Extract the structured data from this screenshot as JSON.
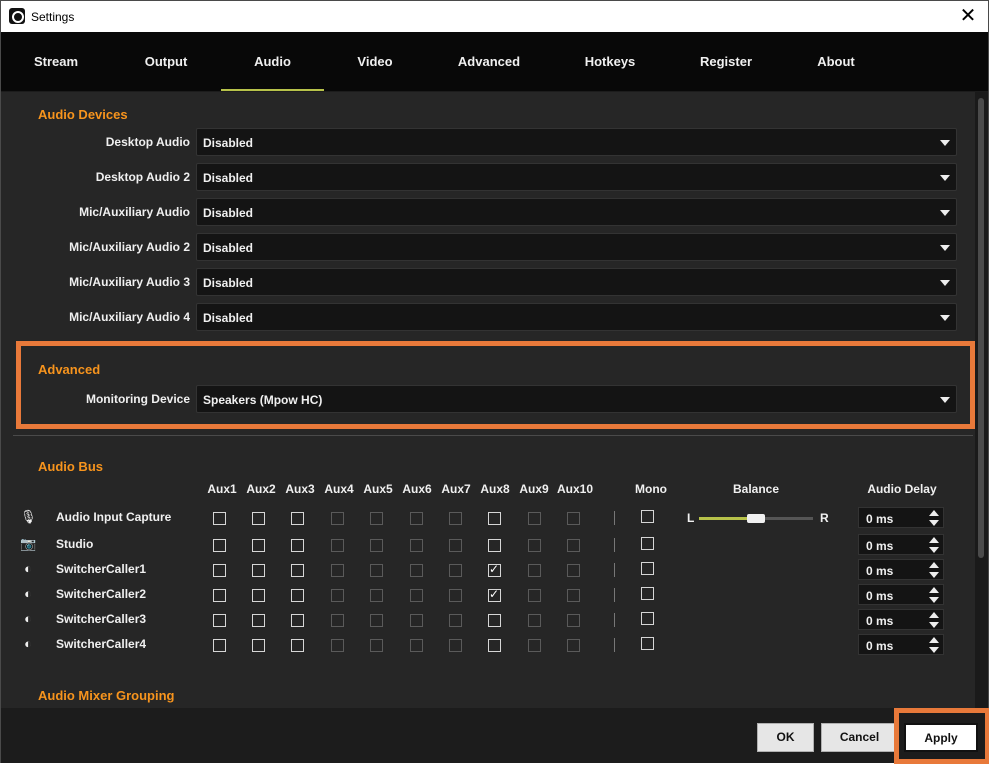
{
  "window": {
    "title": "Settings"
  },
  "tabs": [
    {
      "label": "Stream"
    },
    {
      "label": "Output"
    },
    {
      "label": "Audio"
    },
    {
      "label": "Video"
    },
    {
      "label": "Advanced"
    },
    {
      "label": "Hotkeys"
    },
    {
      "label": "Register"
    },
    {
      "label": "About"
    }
  ],
  "active_tab": "Audio",
  "audio_devices": {
    "title": "Audio Devices",
    "fields": [
      {
        "label": "Desktop Audio",
        "value": "Disabled"
      },
      {
        "label": "Desktop Audio 2",
        "value": "Disabled"
      },
      {
        "label": "Mic/Auxiliary Audio",
        "value": "Disabled"
      },
      {
        "label": "Mic/Auxiliary Audio 2",
        "value": "Disabled"
      },
      {
        "label": "Mic/Auxiliary Audio 3",
        "value": "Disabled"
      },
      {
        "label": "Mic/Auxiliary Audio 4",
        "value": "Disabled"
      }
    ]
  },
  "advanced": {
    "title": "Advanced",
    "monitoring_label": "Monitoring Device",
    "monitoring_value": "Speakers (Mpow HC)"
  },
  "audio_bus": {
    "title": "Audio Bus",
    "columns": [
      "Aux1",
      "Aux2",
      "Aux3",
      "Aux4",
      "Aux5",
      "Aux6",
      "Aux7",
      "Aux8",
      "Aux9",
      "Aux10"
    ],
    "mono_label": "Mono",
    "balance_label": "Balance",
    "balance_left": "L",
    "balance_right": "R",
    "balance_level": 0.5,
    "delay_label": "Audio Delay",
    "rows": [
      {
        "name": "Audio Input Capture",
        "icon": "microphone-icon",
        "checked": [],
        "delay": "0 ms",
        "has_balance": true
      },
      {
        "name": "Studio",
        "icon": "camera-icon",
        "checked": [],
        "delay": "0 ms",
        "has_balance": false
      },
      {
        "name": "SwitcherCaller1",
        "icon": "switcher-icon",
        "checked": [
          8
        ],
        "delay": "0 ms",
        "has_balance": false
      },
      {
        "name": "SwitcherCaller2",
        "icon": "switcher-icon",
        "checked": [
          8
        ],
        "delay": "0 ms",
        "has_balance": false
      },
      {
        "name": "SwitcherCaller3",
        "icon": "switcher-icon",
        "checked": [],
        "delay": "0 ms",
        "has_balance": false
      },
      {
        "name": "SwitcherCaller4",
        "icon": "switcher-icon",
        "checked": [],
        "delay": "0 ms",
        "has_balance": false
      }
    ],
    "dim_columns": [
      4,
      5,
      6,
      7,
      9,
      10
    ]
  },
  "audio_mixer_grouping": {
    "title": "Audio Mixer Grouping"
  },
  "footer": {
    "ok": "OK",
    "cancel": "Cancel",
    "apply": "Apply"
  },
  "colors": {
    "accent": "#f7941d",
    "highlight": "#e8793a",
    "active_tab": "#b7c24a"
  }
}
